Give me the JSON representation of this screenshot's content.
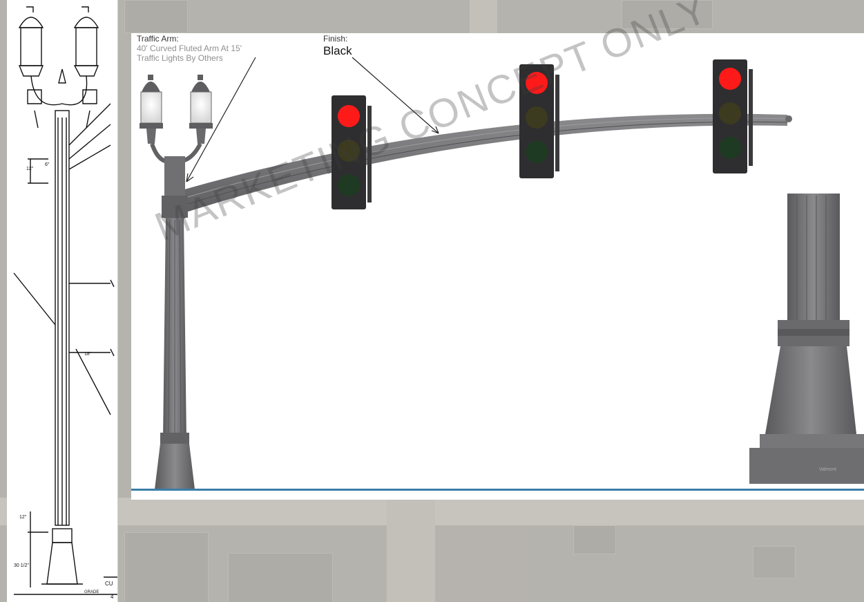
{
  "callouts": {
    "arm": {
      "heading": "Traffic Arm:",
      "line1": "40' Curved Fluted Arm At 15'",
      "line2": "Traffic Lights By Others"
    },
    "finish": {
      "heading": "Finish:",
      "value": "Black"
    }
  },
  "watermark": "MARKETING CONCEPT ONLY",
  "drawing_labels": {
    "dim_6": "6\"",
    "dim_12_top": "12\"",
    "dim_18": "18\"",
    "dim_12_bottom": "12\"",
    "dim_30": "30 1/2\"",
    "grade": "GRADE",
    "cu": "CU",
    "four": "4"
  },
  "brand_mark": "Valmont",
  "colors": {
    "pole_grey": "#6f6f72",
    "signal_housing": "#2e2e30",
    "signal_red": "#ff1a1a",
    "signal_amber_off": "#3d3b1f",
    "signal_green_off": "#1f3a22",
    "accent_line": "#3b7ea8"
  }
}
